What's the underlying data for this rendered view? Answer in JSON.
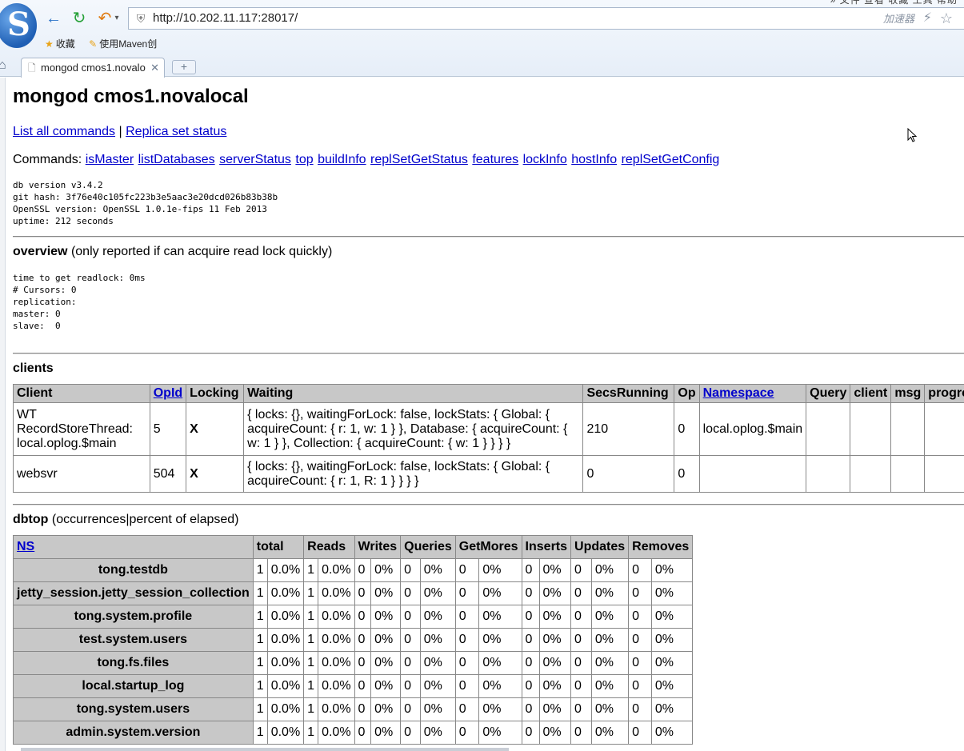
{
  "browser": {
    "logo_letter": "S",
    "menu_top": "» 文件 查看 收藏 工具 帮助",
    "url": "http://10.202.11.117:28017/",
    "accelerator": "加速器",
    "bookmarks": [
      "收藏",
      "使用Maven创"
    ],
    "tab_title": "mongod cmos1.novalo",
    "new_tab": "+"
  },
  "page": {
    "title": "mongod cmos1.novalocal",
    "nav_links": [
      "List all commands",
      "Replica set status"
    ],
    "nav_sep": "|",
    "commands_label": "Commands:",
    "commands": [
      "isMaster",
      "listDatabases",
      "serverStatus",
      "top",
      "buildInfo",
      "replSetGetStatus",
      "features",
      "lockInfo",
      "hostInfo",
      "replSetGetConfig"
    ],
    "version_info": "db version v3.4.2\ngit hash: 3f76e40c105fc223b3e5aac3e20dcd026b83b38b\nOpenSSL version: OpenSSL 1.0.1e-fips 11 Feb 2013\nuptime: 212 seconds",
    "overview": {
      "title": "overview",
      "note": "(only reported if can acquire read lock quickly)",
      "details": "time to get readlock: 0ms\n# Cursors: 0\nreplication:\nmaster: 0\nslave:  0"
    },
    "clients": {
      "title": "clients",
      "columns": [
        "Client",
        "OpId",
        "Locking",
        "Waiting",
        "SecsRunning",
        "Op",
        "Namespace",
        "Query",
        "client",
        "msg",
        "progress"
      ],
      "rows": [
        [
          "WT RecordStoreThread: local.oplog.$main",
          "5",
          "X",
          "{ locks: {}, waitingForLock: false, lockStats: { Global: { acquireCount: { r: 1, w: 1 } }, Database: { acquireCount: { w: 1 } }, Collection: { acquireCount: { w: 1 } } } }",
          "210",
          "0",
          "local.oplog.$main",
          "",
          "",
          "",
          ""
        ],
        [
          "websvr",
          "504",
          "X",
          "{ locks: {}, waitingForLock: false, lockStats: { Global: { acquireCount: { r: 1, R: 1 } } } }",
          "0",
          "0",
          "",
          "",
          "",
          "",
          ""
        ]
      ]
    },
    "dbtop": {
      "title": "dbtop",
      "note": "(occurrences|percent of elapsed)",
      "columns": [
        "NS",
        "total",
        "Reads",
        "Writes",
        "Queries",
        "GetMores",
        "Inserts",
        "Updates",
        "Removes"
      ],
      "rows": [
        [
          "tong.testdb",
          "1",
          "0.0%",
          "1",
          "0.0%",
          "0",
          "0%",
          "0",
          "0%",
          "0",
          "0%",
          "0",
          "0%",
          "0",
          "0%",
          "0",
          "0%"
        ],
        [
          "jetty_session.jetty_session_collection",
          "1",
          "0.0%",
          "1",
          "0.0%",
          "0",
          "0%",
          "0",
          "0%",
          "0",
          "0%",
          "0",
          "0%",
          "0",
          "0%",
          "0",
          "0%"
        ],
        [
          "tong.system.profile",
          "1",
          "0.0%",
          "1",
          "0.0%",
          "0",
          "0%",
          "0",
          "0%",
          "0",
          "0%",
          "0",
          "0%",
          "0",
          "0%",
          "0",
          "0%"
        ],
        [
          "test.system.users",
          "1",
          "0.0%",
          "1",
          "0.0%",
          "0",
          "0%",
          "0",
          "0%",
          "0",
          "0%",
          "0",
          "0%",
          "0",
          "0%",
          "0",
          "0%"
        ],
        [
          "tong.fs.files",
          "1",
          "0.0%",
          "1",
          "0.0%",
          "0",
          "0%",
          "0",
          "0%",
          "0",
          "0%",
          "0",
          "0%",
          "0",
          "0%",
          "0",
          "0%"
        ],
        [
          "local.startup_log",
          "1",
          "0.0%",
          "1",
          "0.0%",
          "0",
          "0%",
          "0",
          "0%",
          "0",
          "0%",
          "0",
          "0%",
          "0",
          "0%",
          "0",
          "0%"
        ],
        [
          "tong.system.users",
          "1",
          "0.0%",
          "1",
          "0.0%",
          "0",
          "0%",
          "0",
          "0%",
          "0",
          "0%",
          "0",
          "0%",
          "0",
          "0%",
          "0",
          "0%"
        ],
        [
          "admin.system.version",
          "1",
          "0.0%",
          "1",
          "0.0%",
          "0",
          "0%",
          "0",
          "0%",
          "0",
          "0%",
          "0",
          "0%",
          "0",
          "0%",
          "0",
          "0%"
        ]
      ]
    }
  }
}
